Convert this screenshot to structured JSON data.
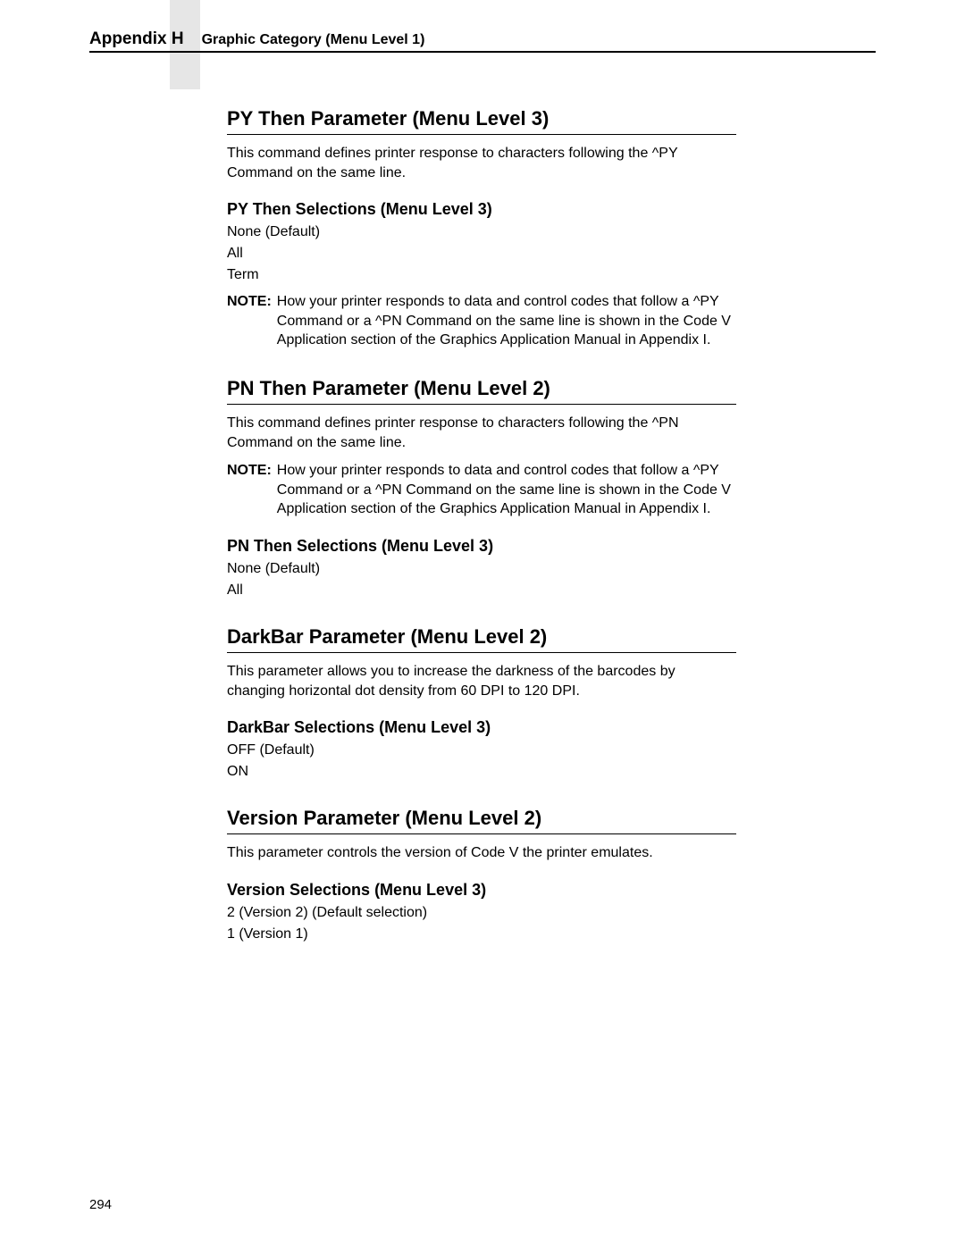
{
  "header": {
    "appendix": "Appendix H",
    "subtitle": "Graphic Category (Menu Level 1)"
  },
  "sections": {
    "pythen": {
      "title": "PY Then Parameter (Menu Level 3)",
      "desc": "This command defines printer response to characters following the ^PY Command on the same line.",
      "sel_title": "PY Then Selections (Menu Level 3)",
      "opts": [
        "None (Default)",
        "All",
        "Term"
      ],
      "note_label": "NOTE:",
      "note": "How your printer responds to data and control codes that follow a ^PY Command or a ^PN Command on the same line is shown in the Code V Application section of the Graphics Application Manual in Appendix I."
    },
    "pnthen": {
      "title": "PN Then Parameter (Menu Level 2)",
      "desc": "This command defines printer response to characters following the ^PN Command on the same line.",
      "note_label": "NOTE:",
      "note": "How your printer responds to data and control codes that follow a ^PY Command or a ^PN Command on the same line is shown in the Code V Application section of the Graphics Application Manual in Appendix I.",
      "sel_title": "PN Then Selections (Menu Level 3)",
      "opts": [
        "None (Default)",
        "All"
      ]
    },
    "darkbar": {
      "title": "DarkBar Parameter (Menu Level 2)",
      "desc": "This parameter allows you to increase the darkness of the barcodes by changing horizontal dot density from 60 DPI to 120 DPI.",
      "sel_title": "DarkBar Selections (Menu Level 3)",
      "opts": [
        "OFF (Default)",
        "ON"
      ]
    },
    "version": {
      "title": "Version Parameter (Menu Level 2)",
      "desc": "This parameter controls the version of Code V the printer emulates.",
      "sel_title": "Version Selections (Menu Level 3)",
      "opts": [
        "2 (Version 2) (Default selection)",
        "1 (Version 1)"
      ]
    }
  },
  "page_number": "294"
}
